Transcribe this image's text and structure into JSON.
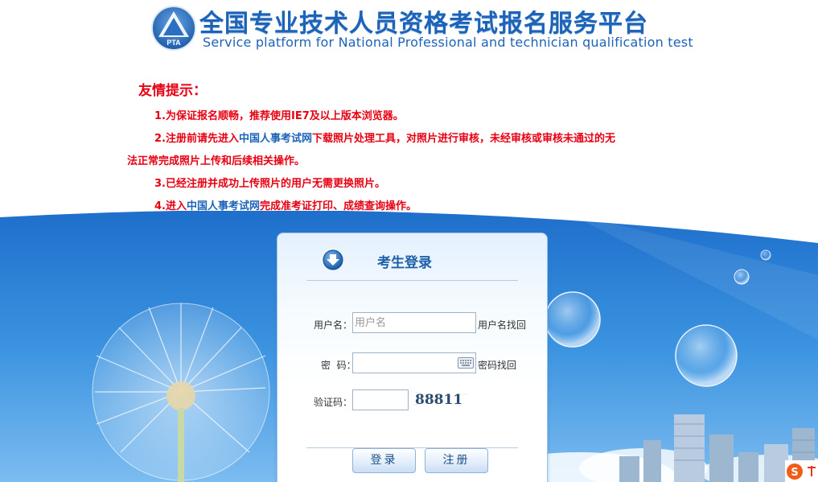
{
  "header": {
    "title_cn": "全国专业技术人员资格考试报名服务平台",
    "title_en": "Service platform for National Professional and technician qualification test",
    "logo_text": "PTA"
  },
  "notice": {
    "title": "友情提示：",
    "items": [
      {
        "prefix": "1.为保证报名顺畅，推荐使用IE7及以上版本浏览器。",
        "link": "",
        "suffix": ""
      },
      {
        "prefix": "2.注册前请先进入",
        "link": "中国人事考试网",
        "suffix": "下载照片处理工具，对照片进行审核，未经审核或审核未通过的无"
      },
      {
        "prefix": "法正常完成照片上传和后续相关操作。",
        "link": "",
        "suffix": ""
      },
      {
        "prefix": "3.已经注册并成功上传照片的用户无需更换照片。",
        "link": "",
        "suffix": ""
      },
      {
        "prefix": "4.进入",
        "link": "中国人事考试网",
        "suffix": "完成准考证打印、成绩查询操作。"
      }
    ]
  },
  "login": {
    "title": "考生登录",
    "username_label": "用户名：",
    "username_placeholder": "用户名",
    "username_recover": "用户名找回",
    "password_label": "密  码：",
    "password_recover": "密码找回",
    "captcha_label": "验证码：",
    "captcha_text": "88811",
    "login_button": "登录",
    "register_button": "注册"
  },
  "colors": {
    "brand_blue": "#1d63b8",
    "notice_red": "#e60012",
    "sky_blue": "#2f86d6"
  }
}
